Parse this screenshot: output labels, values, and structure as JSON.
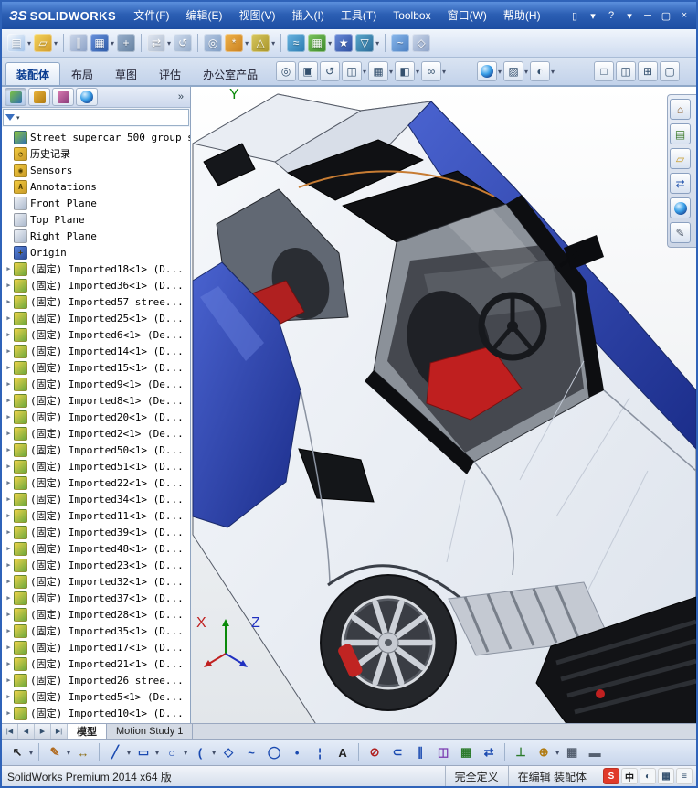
{
  "titlebar": {
    "logo_mark": "ЗS",
    "logo_text": "SOLIDWORKS",
    "menus": [
      "文件(F)",
      "编辑(E)",
      "视图(V)",
      "插入(I)",
      "工具(T)",
      "Toolbox",
      "窗口(W)",
      "帮助(H)"
    ],
    "controls": [
      {
        "name": "quick-new-document-icon",
        "glyph": "▯"
      },
      {
        "name": "quick-new-dropdown-icon",
        "glyph": "▾"
      },
      {
        "name": "help-icon",
        "glyph": "?"
      },
      {
        "name": "help-dropdown-icon",
        "glyph": "▾"
      },
      {
        "name": "minimize-button",
        "glyph": "─"
      },
      {
        "name": "restore-button",
        "glyph": "▢"
      },
      {
        "name": "close-button",
        "glyph": "×"
      }
    ]
  },
  "toolbar": {
    "icons": [
      {
        "name": "new-document-icon",
        "c1": "#f8fafd",
        "c2": "#9fc0e8",
        "g": "▤",
        "dd": true
      },
      {
        "name": "open-document-icon",
        "c1": "#f4d35a",
        "c2": "#d09a2c",
        "g": "▱",
        "dd": true
      },
      {
        "sep": true
      },
      {
        "name": "mate-icon",
        "c1": "#cdd8ea",
        "c2": "#8aa0c6",
        "g": "∥"
      },
      {
        "name": "linear-component-pattern-icon",
        "c1": "#6a92dc",
        "c2": "#2c5aa8",
        "g": "▦",
        "dd": true
      },
      {
        "name": "smart-fasteners-icon",
        "c1": "#9ab0cc",
        "c2": "#64809f",
        "g": "+"
      },
      {
        "sep": true
      },
      {
        "name": "move-component-icon",
        "c1": "#e2e8f2",
        "c2": "#aab8cc",
        "g": "⇄",
        "dd": true
      },
      {
        "name": "rotate-component-icon",
        "c1": "#cfdcee",
        "c2": "#93aac8",
        "g": "↺"
      },
      {
        "sep": true
      },
      {
        "name": "show-hidden-components-icon",
        "c1": "#b7c9e2",
        "c2": "#7e9cc4",
        "g": "◎"
      },
      {
        "name": "assembly-features-icon",
        "c1": "#f0b34a",
        "c2": "#c87f1f",
        "g": "*",
        "dd": true
      },
      {
        "name": "reference-geometry-icon",
        "c1": "#d8c860",
        "c2": "#a89428",
        "g": "△",
        "dd": true
      },
      {
        "sep": true
      },
      {
        "name": "new-motion-study-icon",
        "c1": "#6ab4e0",
        "c2": "#2a7ab0",
        "g": "≈"
      },
      {
        "name": "bill-of-materials-icon",
        "c1": "#7cc45f",
        "c2": "#3c8a2a",
        "g": "▦",
        "dd": true
      },
      {
        "name": "exploded-view-icon",
        "c1": "#6a8ad8",
        "c2": "#2c4ea0",
        "g": "★"
      },
      {
        "name": "interference-detection-icon",
        "c1": "#5aa8cc",
        "c2": "#2a6a98",
        "g": "▽",
        "dd": true
      },
      {
        "sep": true
      },
      {
        "name": "instant3d-icon",
        "c1": "#8ab8ec",
        "c2": "#4a7ec0",
        "g": "~"
      },
      {
        "name": "large-design-review-icon",
        "c1": "#cdd8ea",
        "c2": "#8aa0c6",
        "g": "◇"
      }
    ]
  },
  "commandmanager": {
    "tabs": [
      {
        "label": "装配体",
        "active": true
      },
      {
        "label": "布局",
        "active": false
      },
      {
        "label": "草图",
        "active": false
      },
      {
        "label": "评估",
        "active": false
      },
      {
        "label": "办公室产品",
        "active": false
      }
    ],
    "headsup_group1": [
      {
        "name": "zoom-to-fit-icon",
        "g": "◎"
      },
      {
        "name": "zoom-to-area-icon",
        "g": "▣"
      },
      {
        "name": "previous-view-icon",
        "g": "↺"
      },
      {
        "name": "section-view-icon",
        "g": "◫",
        "dd": true
      },
      {
        "name": "view-orientation-icon",
        "g": "▦",
        "dd": true
      },
      {
        "name": "display-style-icon",
        "g": "◧",
        "dd": true
      },
      {
        "name": "hide-show-items-icon",
        "g": "∞",
        "dd": true
      }
    ],
    "headsup_group2": [
      {
        "name": "edit-appearance-icon",
        "ball": true,
        "dd": true
      },
      {
        "name": "apply-scene-icon",
        "g": "▨",
        "dd": true
      },
      {
        "name": "view-settings-icon",
        "g": "◐",
        "dd": true
      }
    ],
    "headsup_group3": [
      {
        "name": "viewport-single-icon",
        "g": "□"
      },
      {
        "name": "viewport-two-icon",
        "g": "◫"
      },
      {
        "name": "viewport-four-icon",
        "g": "⊞"
      },
      {
        "name": "fullscreen-icon",
        "g": "▢"
      }
    ]
  },
  "leftpanel": {
    "panel_tabs": [
      {
        "name": "featuremanager-tree-tab",
        "c1": "#7ac043",
        "c2": "#2f6fb3",
        "g": "",
        "active": true
      },
      {
        "name": "propertymanager-tab",
        "c1": "#e8b23a",
        "c2": "#b07a10",
        "g": ""
      },
      {
        "name": "configurationmanager-tab",
        "c1": "#d87ab0",
        "c2": "#8a3a7a",
        "g": ""
      },
      {
        "name": "displaymanager-tab",
        "c1": "#4aa0e0",
        "c2": "#2a5ab0",
        "g": "",
        "ball": true
      }
    ],
    "flyout_chevron": "»",
    "tree_icon_colors": {
      "assembly": [
        "#8cc63f",
        "#2f6fb3"
      ],
      "history": [
        "#f3cb3f",
        "#c89a28"
      ],
      "sensors": [
        "#f3cb3f",
        "#c89a28"
      ],
      "annotations": [
        "#f3cb3f",
        "#c89a28"
      ],
      "plane": [
        "#eef1f6",
        "#aab8cc"
      ],
      "origin": [
        "#5a86dc",
        "#2a4a98"
      ],
      "component": [
        "#f0d44a",
        "#6aa83c"
      ]
    },
    "tree_icon_glyphs": {
      "annotations": "A",
      "origin": "+",
      "history": "◔",
      "sensors": "◉"
    },
    "tree": [
      {
        "type": "assembly",
        "expand": false,
        "label": "Street supercar 500 group s"
      },
      {
        "type": "history",
        "expand": false,
        "label": "历史记录"
      },
      {
        "type": "sensors",
        "expand": false,
        "label": "Sensors"
      },
      {
        "type": "annotations",
        "expand": false,
        "label": "Annotations"
      },
      {
        "type": "plane",
        "expand": false,
        "label": "Front Plane"
      },
      {
        "type": "plane",
        "expand": false,
        "label": "Top Plane"
      },
      {
        "type": "plane",
        "expand": false,
        "label": "Right Plane"
      },
      {
        "type": "origin",
        "expand": false,
        "label": "Origin"
      },
      {
        "type": "component",
        "expand": true,
        "label": "(固定) Imported18<1> (D..."
      },
      {
        "type": "component",
        "expand": true,
        "label": "(固定) Imported36<1> (D..."
      },
      {
        "type": "component",
        "expand": true,
        "label": "(固定) Imported57 stree..."
      },
      {
        "type": "component",
        "expand": true,
        "label": "(固定) Imported25<1> (D..."
      },
      {
        "type": "component",
        "expand": true,
        "label": "(固定) Imported6<1> (De..."
      },
      {
        "type": "component",
        "expand": true,
        "label": "(固定) Imported14<1> (D..."
      },
      {
        "type": "component",
        "expand": true,
        "label": "(固定) Imported15<1> (D..."
      },
      {
        "type": "component",
        "expand": true,
        "label": "(固定) Imported9<1> (De..."
      },
      {
        "type": "component",
        "expand": true,
        "label": "(固定) Imported8<1> (De..."
      },
      {
        "type": "component",
        "expand": true,
        "label": "(固定) Imported20<1> (D..."
      },
      {
        "type": "component",
        "expand": true,
        "label": "(固定) Imported2<1> (De..."
      },
      {
        "type": "component",
        "expand": true,
        "label": "(固定) Imported50<1> (D..."
      },
      {
        "type": "component",
        "expand": true,
        "label": "(固定) Imported51<1> (D..."
      },
      {
        "type": "component",
        "expand": true,
        "label": "(固定) Imported22<1> (D..."
      },
      {
        "type": "component",
        "expand": true,
        "label": "(固定) Imported34<1> (D..."
      },
      {
        "type": "component",
        "expand": true,
        "label": "(固定) Imported11<1> (D..."
      },
      {
        "type": "component",
        "expand": true,
        "label": "(固定) Imported39<1> (D..."
      },
      {
        "type": "component",
        "expand": true,
        "label": "(固定) Imported48<1> (D..."
      },
      {
        "type": "component",
        "expand": true,
        "label": "(固定) Imported23<1> (D..."
      },
      {
        "type": "component",
        "expand": true,
        "label": "(固定) Imported32<1> (D..."
      },
      {
        "type": "component",
        "expand": true,
        "label": "(固定) Imported37<1> (D..."
      },
      {
        "type": "component",
        "expand": true,
        "label": "(固定) Imported28<1> (D..."
      },
      {
        "type": "component",
        "expand": true,
        "label": "(固定) Imported35<1> (D..."
      },
      {
        "type": "component",
        "expand": true,
        "label": "(固定) Imported17<1> (D..."
      },
      {
        "type": "component",
        "expand": true,
        "label": "(固定) Imported21<1> (D..."
      },
      {
        "type": "component",
        "expand": true,
        "label": "(固定) Imported26 stree..."
      },
      {
        "type": "component",
        "expand": true,
        "label": "(固定) Imported5<1> (De..."
      },
      {
        "type": "component",
        "expand": true,
        "label": "(固定) Imported10<1> (D..."
      }
    ]
  },
  "taskpane": [
    {
      "name": "solidworks-resources-icon",
      "glyph": "⌂",
      "col": "#8a5a28"
    },
    {
      "name": "design-library-icon",
      "glyph": "▤",
      "col": "#3a7a28"
    },
    {
      "name": "file-explorer-icon",
      "glyph": "▱",
      "col": "#c89a28"
    },
    {
      "name": "view-palette-icon",
      "glyph": "⇄",
      "col": "#2a5ab0"
    },
    {
      "name": "appearances-scenes-icon",
      "ball": true
    },
    {
      "name": "custom-properties-icon",
      "glyph": "✎",
      "col": "#556070"
    }
  ],
  "viewport": {
    "triad_x": "X",
    "triad_y": "Y",
    "triad_z": "Z",
    "model_colors": {
      "body": "#eef1f5",
      "accent_blue": "#2b44ad",
      "canopy": "#101114",
      "interior_red": "#bf1f1f"
    }
  },
  "bottomtabs": {
    "nav": [
      {
        "name": "first-tab-button",
        "glyph": "|◀"
      },
      {
        "name": "prev-tab-button",
        "glyph": "◀"
      },
      {
        "name": "next-tab-button",
        "glyph": "▶"
      },
      {
        "name": "last-tab-button",
        "glyph": "▶|"
      }
    ],
    "tabs": [
      {
        "label": "模型",
        "active": true
      },
      {
        "label": "Motion Study 1",
        "active": false
      }
    ]
  },
  "sketchbar": {
    "icons": [
      {
        "name": "select-tool-icon",
        "g": "↖",
        "col": "#222222",
        "dd": true
      },
      {
        "sep": true
      },
      {
        "name": "sketch-tool-icon",
        "g": "✎",
        "col": "#b06a1f",
        "dd": true
      },
      {
        "name": "smart-dimension-icon",
        "g": "↔",
        "col": "#8a6a10"
      },
      {
        "sep": true
      },
      {
        "name": "line-icon",
        "g": "╱",
        "col": "#1a4ab0",
        "dd": true
      },
      {
        "name": "rectangle-icon",
        "g": "▭",
        "col": "#1a4ab0",
        "dd": true
      },
      {
        "name": "circle-icon",
        "g": "○",
        "col": "#1a4ab0",
        "dd": true
      },
      {
        "name": "arc-icon",
        "g": "(",
        "col": "#1a4ab0",
        "dd": true
      },
      {
        "name": "polygon-icon",
        "g": "◇",
        "col": "#1a4ab0"
      },
      {
        "name": "spline-icon",
        "g": "~",
        "col": "#1a4ab0"
      },
      {
        "name": "ellipse-icon",
        "g": "◯",
        "col": "#1a4ab0"
      },
      {
        "name": "point-icon",
        "g": "•",
        "col": "#1a4ab0"
      },
      {
        "name": "centerline-icon",
        "g": "¦",
        "col": "#1a4ab0"
      },
      {
        "name": "text-icon",
        "g": "A",
        "col": "#222222"
      },
      {
        "sep": true
      },
      {
        "name": "trim-entities-icon",
        "g": "⊘",
        "col": "#b02020"
      },
      {
        "name": "convert-entities-icon",
        "g": "⊂",
        "col": "#1a4ab0"
      },
      {
        "name": "offset-entities-icon",
        "g": "∥",
        "col": "#1a4ab0"
      },
      {
        "name": "mirror-entities-icon",
        "g": "◫",
        "col": "#7a3ab0"
      },
      {
        "name": "linear-sketch-pattern-icon",
        "g": "▦",
        "col": "#2a7a2a"
      },
      {
        "name": "move-entities-icon",
        "g": "⇄",
        "col": "#1a4ab0"
      },
      {
        "sep": true
      },
      {
        "name": "display-relations-icon",
        "g": "⊥",
        "col": "#2a7a2a"
      },
      {
        "name": "quick-snaps-icon",
        "g": "⊕",
        "col": "#b07a10",
        "dd": true
      },
      {
        "name": "grid-snap-icon",
        "g": "▦",
        "col": "#556070"
      },
      {
        "name": "ruler-icon",
        "g": "▬",
        "col": "#556070"
      }
    ]
  },
  "statusbar": {
    "left_text": "SolidWorks Premium 2014 x64 版",
    "cells": [
      "完全定义",
      "在编辑 装配体"
    ],
    "tray": [
      {
        "name": "sogou-input-icon",
        "label": "S",
        "bg": "#e03a2a",
        "col": "#ffffff"
      },
      {
        "name": "ime-chinese-mode-icon",
        "label": "中",
        "bg": "#f4f6f8",
        "col": "#111111"
      },
      {
        "name": "ime-halfwidth-icon",
        "label": "◐",
        "bg": "#f4f6f8",
        "col": "#34506e"
      },
      {
        "name": "ime-keyboard-icon",
        "label": "▦",
        "bg": "#f4f6f8",
        "col": "#34506e"
      },
      {
        "name": "ime-menu-icon",
        "label": "≡",
        "bg": "#f4f6f8",
        "col": "#34506e"
      }
    ]
  }
}
